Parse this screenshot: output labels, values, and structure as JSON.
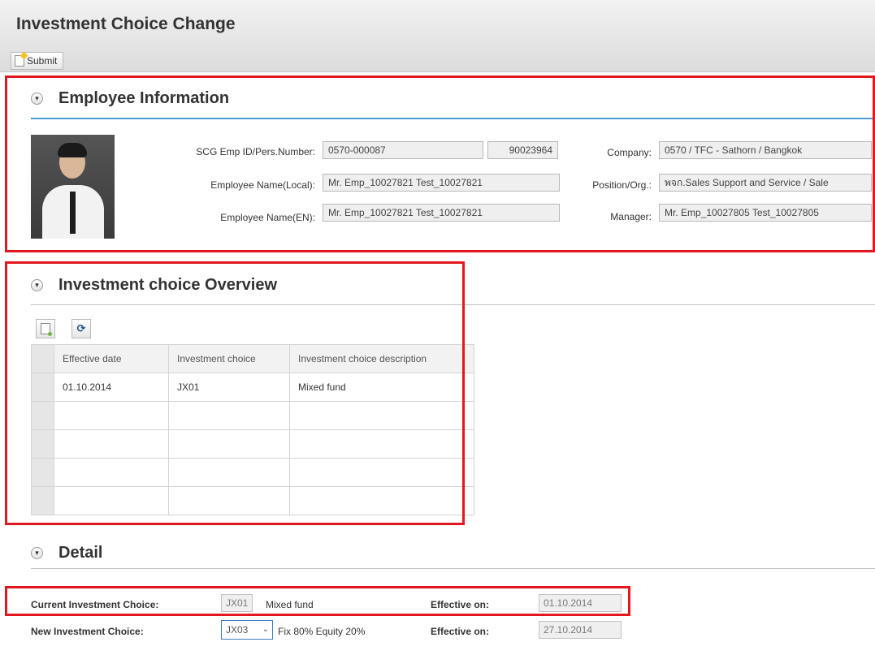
{
  "window": {
    "title": "Investment Choice Change"
  },
  "toolbar": {
    "submit_label": "Submit"
  },
  "employee_section": {
    "title": "Employee Information",
    "emp_id_label": "SCG Emp ID/Pers.Number:",
    "emp_id_value": "0570-000087",
    "pers_number_value": "90023964",
    "name_local_label": "Employee Name(Local):",
    "name_local_value": "Mr. Emp_10027821 Test_10027821",
    "name_en_label": "Employee Name(EN):",
    "name_en_value": "Mr. Emp_10027821 Test_10027821",
    "company_label": "Company:",
    "company_value": "0570 / TFC - Sathorn / Bangkok",
    "position_label": "Position/Org.:",
    "position_value": "พจก.Sales Support and Service / Sale",
    "manager_label": "Manager:",
    "manager_value": "Mr. Emp_10027805 Test_10027805"
  },
  "overview_section": {
    "title": "Investment choice Overview",
    "columns": [
      "Effective date",
      "Investment choice",
      "Investment choice description"
    ],
    "rows": [
      [
        "01.10.2014",
        "JX01",
        "Mixed fund"
      ],
      [
        "",
        "",
        ""
      ],
      [
        "",
        "",
        ""
      ],
      [
        "",
        "",
        ""
      ],
      [
        "",
        "",
        ""
      ]
    ]
  },
  "detail_section": {
    "title": "Detail",
    "current_label": "Current Investment Choice:",
    "current_code": "JX01",
    "current_desc": "Mixed fund",
    "current_effective_label": "Effective on:",
    "current_effective_value": "01.10.2014",
    "new_label": "New Investment Choice:",
    "new_code": "JX03",
    "new_desc": "Fix 80% Equity 20%",
    "new_effective_label": "Effective on:",
    "new_effective_value": "27.10.2014"
  },
  "colors": {
    "highlight": "#e3181f",
    "section_rule": "#4e9cd0"
  }
}
